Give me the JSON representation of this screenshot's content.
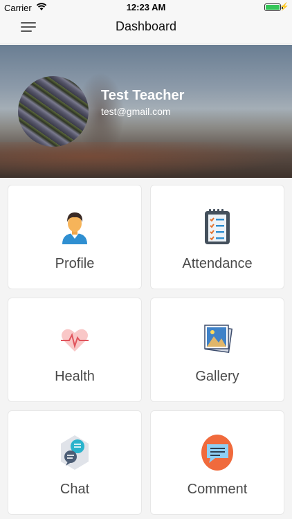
{
  "status_bar": {
    "carrier": "Carrier",
    "time": "12:23 AM",
    "battery_level": 1.0
  },
  "nav": {
    "title": "Dashboard"
  },
  "profile": {
    "name": "Test Teacher",
    "email": "test@gmail.com"
  },
  "tiles": [
    {
      "label": "Profile",
      "icon": "profile-icon"
    },
    {
      "label": "Attendance",
      "icon": "checklist-icon"
    },
    {
      "label": "Health",
      "icon": "heartbeat-icon"
    },
    {
      "label": "Gallery",
      "icon": "gallery-icon"
    },
    {
      "label": "Chat",
      "icon": "chat-icon"
    },
    {
      "label": "Comment",
      "icon": "comment-icon"
    }
  ]
}
